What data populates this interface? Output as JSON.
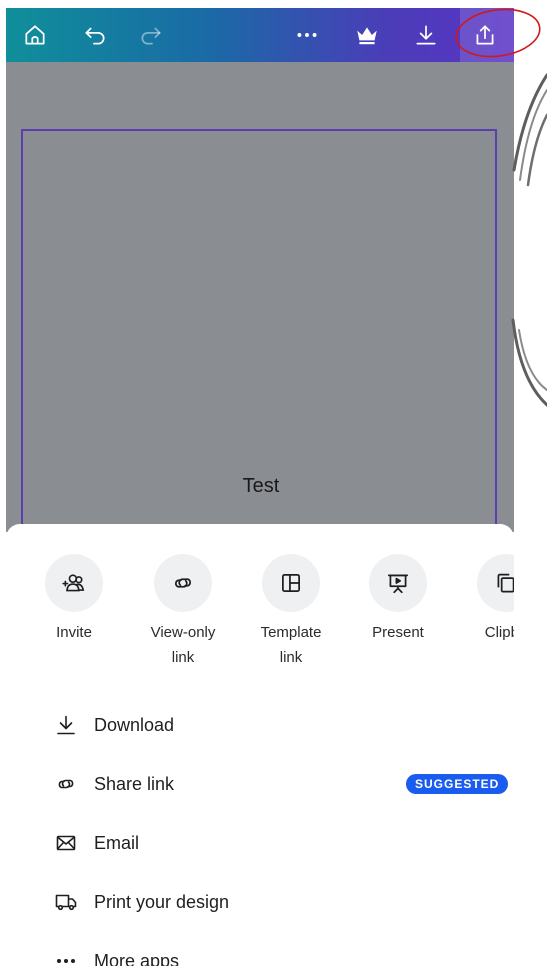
{
  "toolbar": {
    "icons": [
      "home-icon",
      "undo-icon",
      "redo-icon",
      "more-icon",
      "crown-icon",
      "download-icon",
      "share-icon"
    ]
  },
  "canvas": {
    "text": "Test"
  },
  "share_sheet": {
    "quick_actions": [
      {
        "label": "Invite",
        "icon": "invite-people-icon"
      },
      {
        "label": "View-only\nlink",
        "icon": "link-icon"
      },
      {
        "label": "Template\nlink",
        "icon": "template-icon"
      },
      {
        "label": "Present",
        "icon": "present-icon"
      },
      {
        "label": "Clipbo",
        "icon": "clipboard-icon"
      }
    ],
    "items": [
      {
        "label": "Download",
        "icon": "download-icon"
      },
      {
        "label": "Share link",
        "icon": "link-icon",
        "badge": "SUGGESTED"
      },
      {
        "label": "Email",
        "icon": "email-icon"
      },
      {
        "label": "Print your design",
        "icon": "truck-icon"
      },
      {
        "label": "More apps",
        "icon": "more-icon"
      }
    ]
  },
  "colors": {
    "toolbar_gradient_start": "#0f8f9a",
    "toolbar_gradient_end": "#5a33c6",
    "canvas_bg": "#8a8d92",
    "page_border": "#5b3fb0",
    "badge_bg": "#1a5cf0",
    "annotation_red": "#d0191b"
  }
}
